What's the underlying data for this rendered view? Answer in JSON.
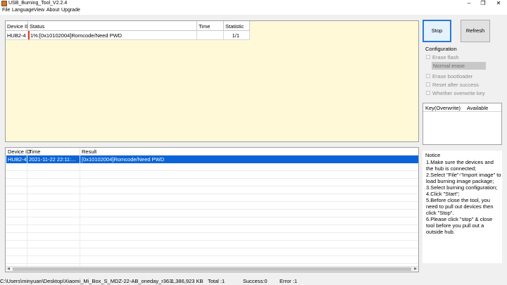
{
  "window": {
    "title": "USB_Burning_Tool_V2.2.4"
  },
  "menu": [
    "File",
    "Language",
    "View",
    "About",
    "Upgrade"
  ],
  "device_grid": {
    "headers": [
      "Device ID",
      "Status",
      "Time",
      "Statistic"
    ],
    "rows": [
      {
        "device": "HUB2-4",
        "status": "1%:[0x10102004]Romcode/Need PWD",
        "time": "",
        "statistic": "1/1",
        "progress_percent": 1
      }
    ]
  },
  "buttons": {
    "stop": "Stop",
    "refresh": "Refresh"
  },
  "configuration": {
    "label": "Configuration",
    "erase_flash": "Erase flash",
    "erase_mode": "Normal erase",
    "erase_bootloader": "Erase bootloader",
    "reset_after_success": "Reset after success",
    "overwrite_key": "Whether overwrite key"
  },
  "key_panel": {
    "col1": "Key(Overwrite)",
    "col2": "Available"
  },
  "notice": {
    "title": "Notice",
    "text": "1.Make sure the devices and the hub is connected;\n2.Select \"File\"-\"Import image\" to load burning image package;\n3.Select burning configuration;\n4.Click \"Start\";\n5.Before close the tool, you need to pull out devices then click \"Stop\".\n6.Please click \"stop\" & close tool before you pull out a outside hub."
  },
  "log_grid": {
    "headers": [
      "Device ID",
      "Time",
      "Result"
    ],
    "rows": [
      {
        "device": "HUB2-4",
        "time": "2021-11-22 22:11:...",
        "result": "[0x10102004]Romcode/Need PWD"
      }
    ]
  },
  "status_bar": {
    "path": "C:\\Users\\minyuan\\Desktop\\Xiaomi_Mi_Box_S_MDZ-22-AB_oneday_r363",
    "size": "1,386,923 KB",
    "total": "Total :1",
    "success": "Success:0",
    "error": "Error :1"
  }
}
